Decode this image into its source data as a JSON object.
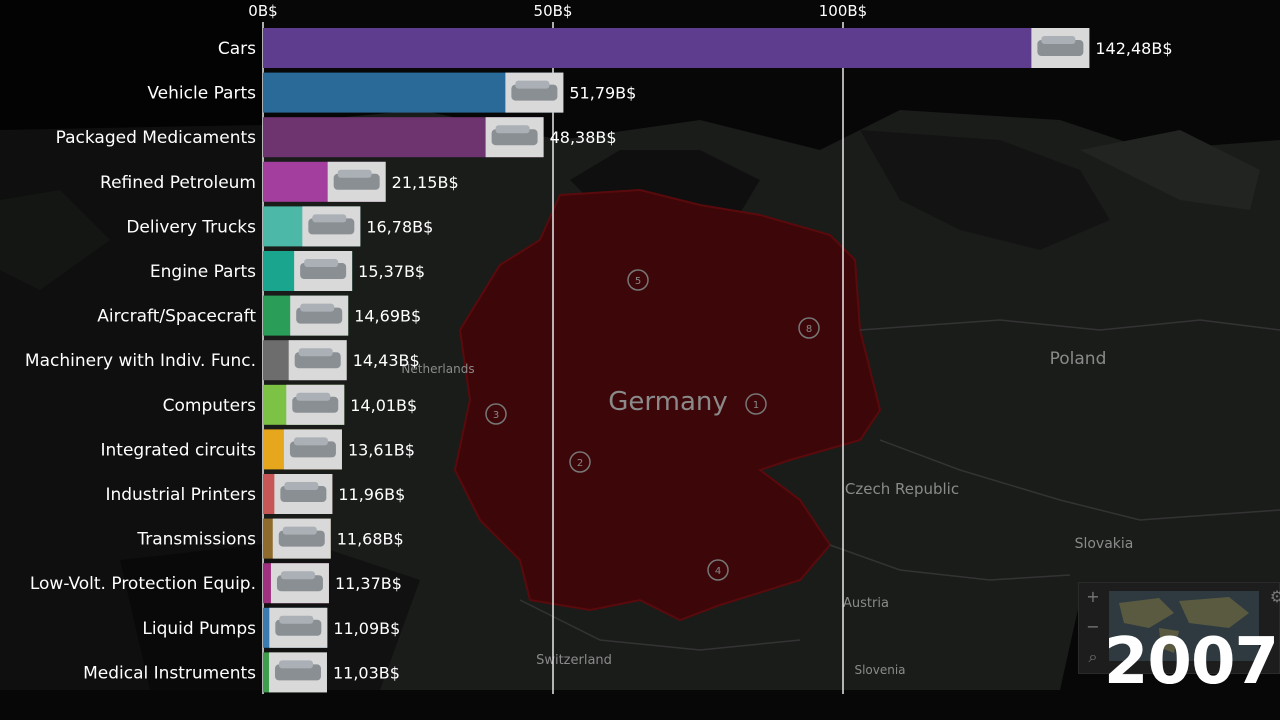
{
  "chart_data": {
    "type": "bar",
    "orientation": "horizontal",
    "categories": [
      "Cars",
      "Vehicle Parts",
      "Packaged Medicaments",
      "Refined Petroleum",
      "Delivery Trucks",
      "Engine Parts",
      "Aircraft/Spacecraft",
      "Machinery with Indiv. Func.",
      "Computers",
      "Integrated circuits",
      "Industrial Printers",
      "Transmissions",
      "Low-Volt. Protection Equip.",
      "Liquid Pumps",
      "Medical Instruments"
    ],
    "values": [
      142.48,
      51.79,
      48.38,
      21.15,
      16.78,
      15.37,
      14.69,
      14.43,
      14.01,
      13.61,
      11.96,
      11.68,
      11.37,
      11.09,
      11.03
    ],
    "value_labels": [
      "142,48B$",
      "51,79B$",
      "48,38B$",
      "21,15B$",
      "16,78B$",
      "15,37B$",
      "14,69B$",
      "14,43B$",
      "14,01B$",
      "13,61B$",
      "11,96B$",
      "11,68B$",
      "11,37B$",
      "11,09B$",
      "11,03B$"
    ],
    "colors": [
      "#5e3d8f",
      "#2a6a99",
      "#6e3470",
      "#a33e9e",
      "#4cb8a8",
      "#1aa58f",
      "#2a9e58",
      "#6d6d6d",
      "#7cc244",
      "#e6a71c",
      "#c75656",
      "#8e6a2c",
      "#a03080",
      "#3a7ab0",
      "#3e9e4e"
    ],
    "icons": [
      "car-photo",
      "vehicle-parts-photo",
      "medicaments-photo",
      "oil-barrels-photo",
      "truck-photo",
      "engine-parts-photo",
      "aircraft-photo",
      "machinery-photo",
      "laptop-photo",
      "circuit-photo",
      "printer-photo",
      "transmission-photo",
      "protection-equip-photo",
      "pump-photo",
      "instruments-photo"
    ],
    "xticks": [
      0,
      50,
      100
    ],
    "xtick_labels": [
      "0B$",
      "50B$",
      "100B$"
    ],
    "xlim": [
      0,
      160
    ],
    "grid": true,
    "year": "2007"
  },
  "map": {
    "country": "Germany",
    "neighbors": [
      "Poland",
      "Czech Republic",
      "Slovakia",
      "Austria",
      "Switzerland",
      "Slovenia",
      "Netherlands"
    ],
    "markers": [
      "1",
      "2",
      "3",
      "4",
      "5",
      "8"
    ]
  }
}
